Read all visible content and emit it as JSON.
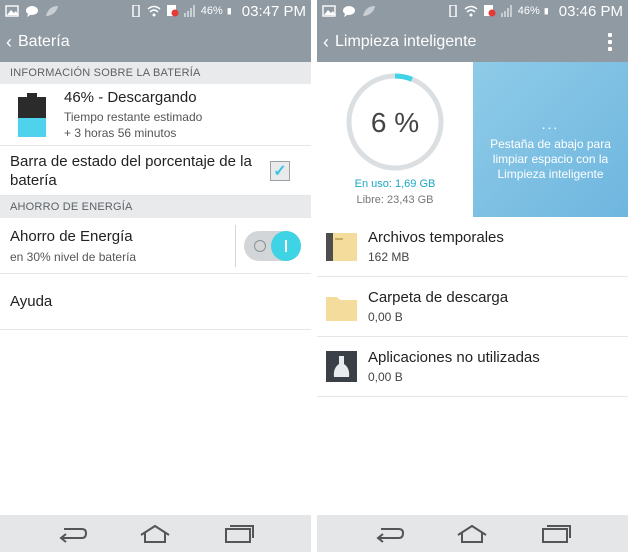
{
  "status_left": {
    "battery_pct": "46%",
    "time": "03:47 PM"
  },
  "status_right": {
    "battery_pct": "46%",
    "time": "03:46 PM"
  },
  "battery_screen": {
    "title": "Batería",
    "section_info": "INFORMACIÓN SOBRE LA BATERÍA",
    "battery_level": 0.46,
    "battery_status": "46% - Descargando",
    "remaining_label": "Tiempo restante estimado",
    "remaining_value": "+ 3 horas 56 minutos",
    "status_bar_pct_label": "Barra de estado del porcentaje de la batería",
    "status_bar_pct_checked": true,
    "section_saving": "AHORRO DE ENERGÍA",
    "saver_title": "Ahorro de Energía",
    "saver_sub": "en 30% nivel de batería",
    "saver_on": true,
    "help": "Ayuda"
  },
  "cleanup_screen": {
    "title": "Limpieza inteligente",
    "usage_pct_text": "6 %",
    "usage_fraction": 0.06,
    "in_use": "En uso: 1,69  GB",
    "free": "Libre: 23,43  GB",
    "hint_dots": "...",
    "hint": "Pestaña de abajo para limpiar espacio con la Limpieza inteligente",
    "items": [
      {
        "name": "Archivos temporales",
        "size": "162  MB"
      },
      {
        "name": "Carpeta de descarga",
        "size": "0,00  B"
      },
      {
        "name": "Aplicaciones no utilizadas",
        "size": "0,00  B"
      }
    ]
  },
  "colors": {
    "accent": "#3fd3e6",
    "bar": "#8f9aa3",
    "section_bg": "#e9eaeb"
  }
}
